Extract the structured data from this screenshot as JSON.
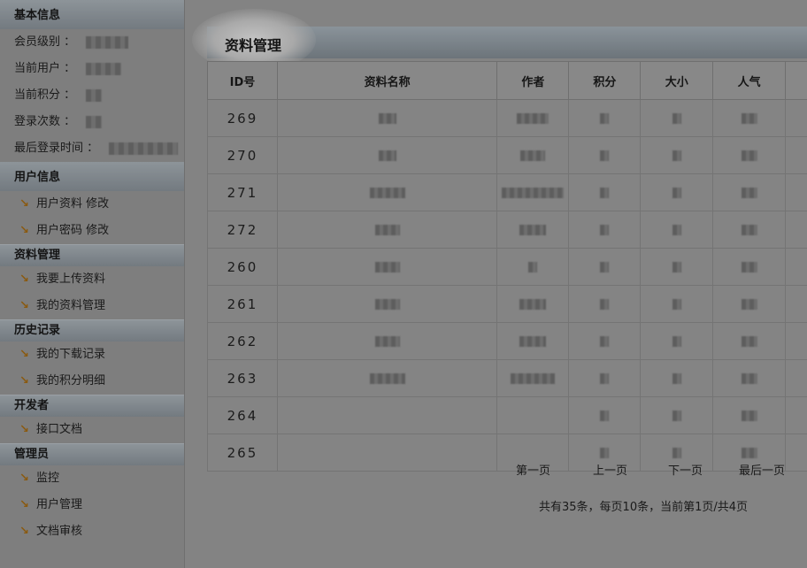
{
  "sidebar": {
    "basic": {
      "title": "基本信息",
      "rows": [
        {
          "label": "会员级别 ：",
          "mask_w": 48
        },
        {
          "label": "当前用户 ：",
          "mask_w": 40
        },
        {
          "label": "当前积分 ：",
          "mask_w": 18
        },
        {
          "label": "登录次数 ：",
          "mask_w": 18
        },
        {
          "label": "最后登录时间 ：",
          "mask_w": 78
        }
      ]
    },
    "sections": [
      {
        "title": "用户信息",
        "items": [
          "用户资料 修改",
          "用户密码 修改"
        ]
      },
      {
        "title": "资料管理",
        "items": [
          "我要上传资料",
          "我的资料管理"
        ]
      },
      {
        "title": "历史记录",
        "items": [
          "我的下载记录",
          "我的积分明细"
        ]
      },
      {
        "title": "开发者",
        "items": [
          "接口文档"
        ]
      },
      {
        "title": "管理员",
        "items": [
          "监控",
          "用户管理",
          "文档审核"
        ]
      }
    ]
  },
  "main": {
    "title": "资料管理",
    "columns": [
      "ID号",
      "资料名称",
      "作者",
      "积分",
      "大小",
      "人气"
    ],
    "rows": [
      {
        "id": "269"
      },
      {
        "id": "270"
      },
      {
        "id": "271"
      },
      {
        "id": "272"
      },
      {
        "id": "260"
      },
      {
        "id": "261"
      },
      {
        "id": "262"
      },
      {
        "id": "263"
      },
      {
        "id": "264"
      },
      {
        "id": "265"
      }
    ],
    "pager": {
      "first": "第一页",
      "prev": "上一页",
      "next": "下一页",
      "last": "最后一页"
    },
    "summary": "共有35条，每页10条，当前第1页/共4页"
  }
}
